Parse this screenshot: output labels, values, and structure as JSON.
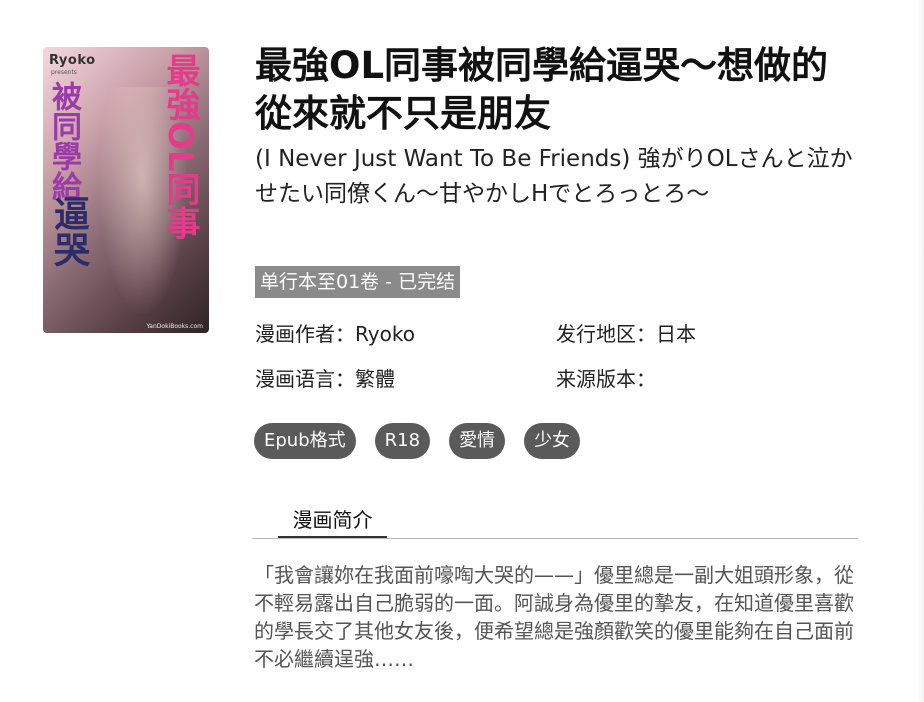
{
  "cover": {
    "brand": "Ryoko",
    "brand_sub": "presents",
    "vertical_title_1": "最強OL同事",
    "vertical_title_2": "被同學給",
    "vertical_title_3": "逼哭",
    "footer": "YanDokiBooks.com"
  },
  "title": "最強OL同事被同學給逼哭～想做的從來就不只是朋友",
  "subtitle": "(I Never Just Want To Be Friends)  強がりOLさんと泣かせたい同僚くん～甘やかしHでとろっとろ～",
  "status": "单行本至01卷 - 已完结",
  "meta": {
    "author": "漫画作者：Ryoko",
    "region": "发行地区：日本",
    "language": "漫画语言：繁體",
    "source": "来源版本："
  },
  "tags": [
    "Epub格式",
    "R18",
    "愛情",
    "少女"
  ],
  "tab_label": "漫画简介",
  "description": "「我會讓妳在我面前嚎啕大哭的——」優里總是一副大姐頭形象，從不輕易露出自己脆弱的一面。阿誠身為優里的摯友，在知道優里喜歡的學長交了其他女友後，便希望總是強顏歡笑的優里能夠在自己面前不必繼續逞強……"
}
